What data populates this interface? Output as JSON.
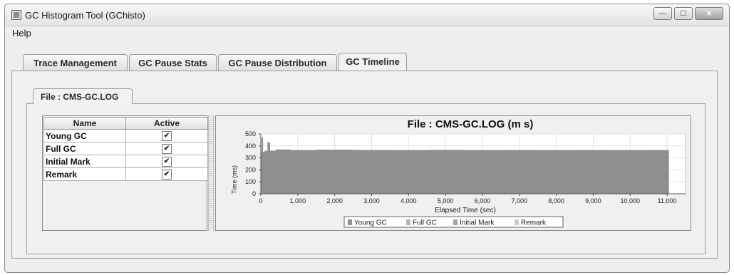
{
  "window": {
    "title": "GC Histogram Tool (GChisto)",
    "controls": {
      "minimize": "—",
      "maximize": "☐",
      "close": "✕"
    }
  },
  "menu": {
    "items": [
      {
        "label": "Help"
      }
    ]
  },
  "tabs": [
    {
      "label": "Trace Management",
      "active": false
    },
    {
      "label": "GC Pause Stats",
      "active": false
    },
    {
      "label": "GC Pause Distribution",
      "active": false
    },
    {
      "label": "GC Timeline",
      "active": true
    }
  ],
  "file_tab": {
    "label": "File : CMS-GC.LOG"
  },
  "gc_table": {
    "headers": [
      "Name",
      "Active"
    ],
    "rows": [
      {
        "name": "Young GC",
        "active": true
      },
      {
        "name": "Full GC",
        "active": true
      },
      {
        "name": "Initial Mark",
        "active": true
      },
      {
        "name": "Remark",
        "active": true
      }
    ],
    "check_glyph": "✔"
  },
  "chart_data": {
    "type": "area",
    "title": "File : CMS-GC.LOG (m s)",
    "xlabel": "Elapsed Time (sec)",
    "ylabel": "Time (ms)",
    "xlim": [
      0,
      11500
    ],
    "ylim": [
      0,
      500
    ],
    "x_ticks": [
      0,
      1000,
      2000,
      3000,
      4000,
      5000,
      6000,
      7000,
      8000,
      9000,
      10000,
      11000
    ],
    "x_tick_labels": [
      "0",
      "1,000",
      "2,000",
      "3,000",
      "4,000",
      "5,000",
      "6,000",
      "7,000",
      "8,000",
      "9,000",
      "10,000",
      "11,000"
    ],
    "y_ticks": [
      0,
      100,
      200,
      300,
      400,
      500
    ],
    "y_tick_labels": [
      "0",
      "100",
      "200",
      "300",
      "400",
      "500"
    ],
    "grid": true,
    "legend_position": "bottom",
    "series": [
      {
        "name": "Young GC",
        "color": "#8f8f8f",
        "x": [
          0,
          20,
          60,
          100,
          180,
          250,
          400,
          800,
          1500,
          2500,
          3500,
          4500,
          5500,
          6500,
          7500,
          8500,
          9500,
          10500,
          11050
        ],
        "values": [
          350,
          470,
          350,
          360,
          430,
          360,
          370,
          365,
          368,
          366,
          365,
          367,
          365,
          366,
          365,
          366,
          365,
          366,
          365
        ]
      },
      {
        "name": "Full GC",
        "color": "#b4b4b4",
        "x": [],
        "values": []
      },
      {
        "name": "Initial Mark",
        "color": "#a3a3a3",
        "x": [],
        "values": []
      },
      {
        "name": "Remark",
        "color": "#cbcbcb",
        "x": [],
        "values": []
      }
    ]
  }
}
